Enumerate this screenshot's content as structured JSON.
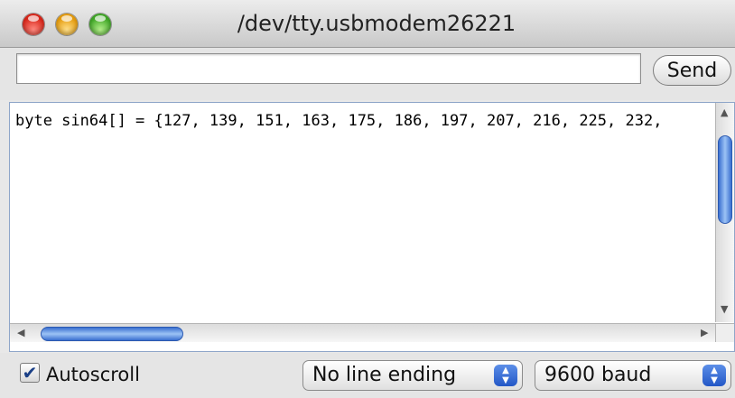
{
  "window": {
    "title": "/dev/tty.usbmodem26221"
  },
  "send": {
    "input_value": "",
    "button_label": "Send"
  },
  "output": {
    "text": "byte sin64[] = {127, 139, 151, 163, 175, 186, 197, 207, 216, 225, 232,"
  },
  "footer": {
    "autoscroll_label": "Autoscroll",
    "autoscroll_checked": true,
    "line_ending": "No line ending",
    "baud_rate": "9600 baud"
  },
  "colors": {
    "scroll_thumb": "#4a7fd8",
    "window_bg": "#e8e8e8"
  },
  "icons": {
    "close": "close-icon",
    "minimize": "minimize-icon",
    "zoom": "zoom-icon",
    "check": "checkmark-icon",
    "stepper": "up-down-chevron-icon"
  }
}
